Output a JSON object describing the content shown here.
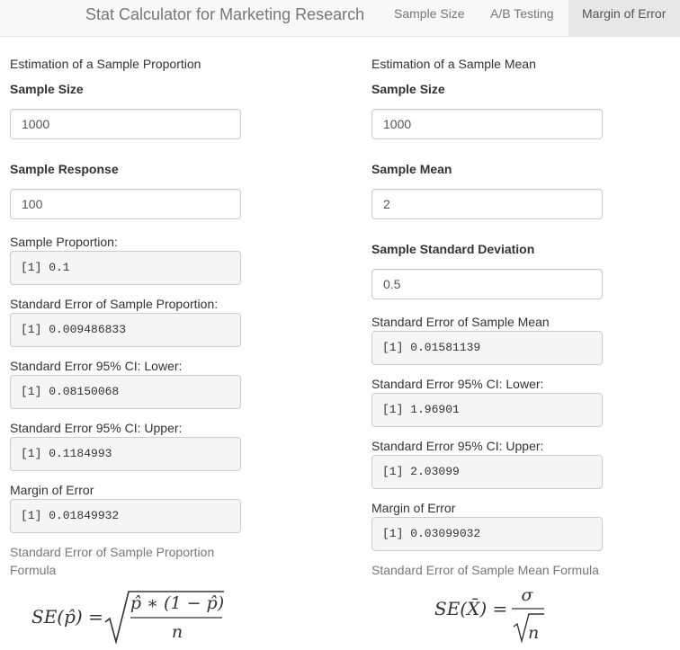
{
  "navbar": {
    "brand": "Stat Calculator for Marketing Research",
    "tabs": [
      {
        "label": "Sample Size",
        "active": false
      },
      {
        "label": "A/B Testing",
        "active": false
      },
      {
        "label": "Margin of Error",
        "active": true
      }
    ]
  },
  "left": {
    "title": "Estimation of a Sample Proportion",
    "sample_size_label": "Sample Size",
    "sample_size_value": "1000",
    "sample_response_label": "Sample Response",
    "sample_response_value": "100",
    "outputs": [
      {
        "label": "Sample Proportion:",
        "value": "[1] 0.1"
      },
      {
        "label": "Standard Error of Sample Proportion:",
        "value": "[1] 0.009486833"
      },
      {
        "label": "Standard Error 95% CI: Lower:",
        "value": "[1] 0.08150068"
      },
      {
        "label": "Standard Error 95% CI: Upper:",
        "value": "[1] 0.1184993"
      },
      {
        "label": "Margin of Error",
        "value": "[1] 0.01849932"
      }
    ],
    "formula_title": "Standard Error of Sample Proportion Formula",
    "formula": {
      "lhs": "SE(p̂) =",
      "numerator": "p̂ ∗ (1 − p̂)",
      "denominator": "n"
    }
  },
  "right": {
    "title": "Estimation of a Sample Mean",
    "sample_size_label": "Sample Size",
    "sample_size_value": "1000",
    "sample_mean_label": "Sample Mean",
    "sample_mean_value": "2",
    "sample_sd_label": "Sample Standard Deviation",
    "sample_sd_value": "0.5",
    "outputs": [
      {
        "label": "Standard Error of Sample Mean",
        "value": "[1] 0.01581139"
      },
      {
        "label": "Standard Error 95% CI: Lower:",
        "value": "[1] 1.96901"
      },
      {
        "label": "Standard Error 95% CI: Upper:",
        "value": "[1] 2.03099"
      },
      {
        "label": "Margin of Error",
        "value": "[1] 0.03099032"
      }
    ],
    "formula_title": "Standard Error of Sample Mean Formula",
    "formula": {
      "lhs": "SE(X̄) =",
      "numerator": "σ",
      "denominator": "n"
    }
  }
}
